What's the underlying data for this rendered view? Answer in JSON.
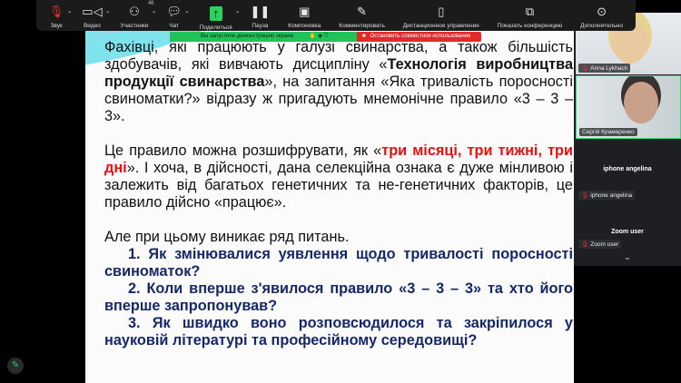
{
  "toolbar": {
    "items": [
      {
        "label": "Звук",
        "icon": "mic-muted-icon"
      },
      {
        "label": "Видео",
        "icon": "video-icon"
      },
      {
        "label": "Участники",
        "icon": "participants-icon",
        "count": "46"
      },
      {
        "label": "Чат",
        "icon": "chat-icon"
      },
      {
        "label": "Поделиться",
        "icon": "share-screen-icon"
      },
      {
        "label": "Пауза",
        "icon": "pause-icon"
      },
      {
        "label": "Компоновка",
        "icon": "layout-icon"
      },
      {
        "label": "Комментировать",
        "icon": "annotate-icon"
      },
      {
        "label": "Дистанционное управление",
        "icon": "remote-control-icon"
      },
      {
        "label": "Показать конференцию",
        "icon": "show-meeting-icon"
      },
      {
        "label": "Дополнительно",
        "icon": "more-icon"
      }
    ]
  },
  "banner": {
    "sharing": "Вы запустили демонстрацию экрана",
    "stop": "Остановить совместное использование",
    "colors": {
      "sharing": "#22c25a",
      "stop": "#e12b2b"
    }
  },
  "slide": {
    "p1": {
      "a": "Фахівці, які працюють у галузі свинарства, а також більшість здобувачів, які вивчають дисципліну «",
      "b": "Технологія виробництва продукції свинарства",
      "c": "», на запитання «Яка тривалість поросності свиноматки?» відразу ж пригадують мнемонічне правило «3 – 3 – 3»."
    },
    "p2": {
      "a": "Це правило можна розшифрувати, як «",
      "b": "три місяці, три тижні, три дні",
      "c": "». І хоча, в дійсності, дана селекційна ознака є дуже мінливою і залежить від багатьох генетичних та не-генетичних факторів, це правило дійсно «працює»."
    },
    "p3": "Але при цьому виникає ряд питань.",
    "questions": [
      "1. Як змінювалися уявлення щодо тривалості поросності свиноматок?",
      "2. Коли вперше з'явилося правило «3 – 3 – 3» та хто його вперше запропонував?",
      "3. Як швидко воно розповсюдилося та закріпилося у науковій літературі та професійному середовищі?"
    ],
    "colors": {
      "highlight": "#e81010",
      "questions": "#16286a"
    }
  },
  "participants": {
    "videos": [
      "Anna Lykhach",
      "Сергій Крамаренко"
    ],
    "tiles": [
      {
        "title": "iphone angelina",
        "name": "iphone angelina"
      },
      {
        "title": "Zoom user",
        "name": "Zoom user"
      }
    ],
    "active_speaker_color": "#2ee07a"
  }
}
